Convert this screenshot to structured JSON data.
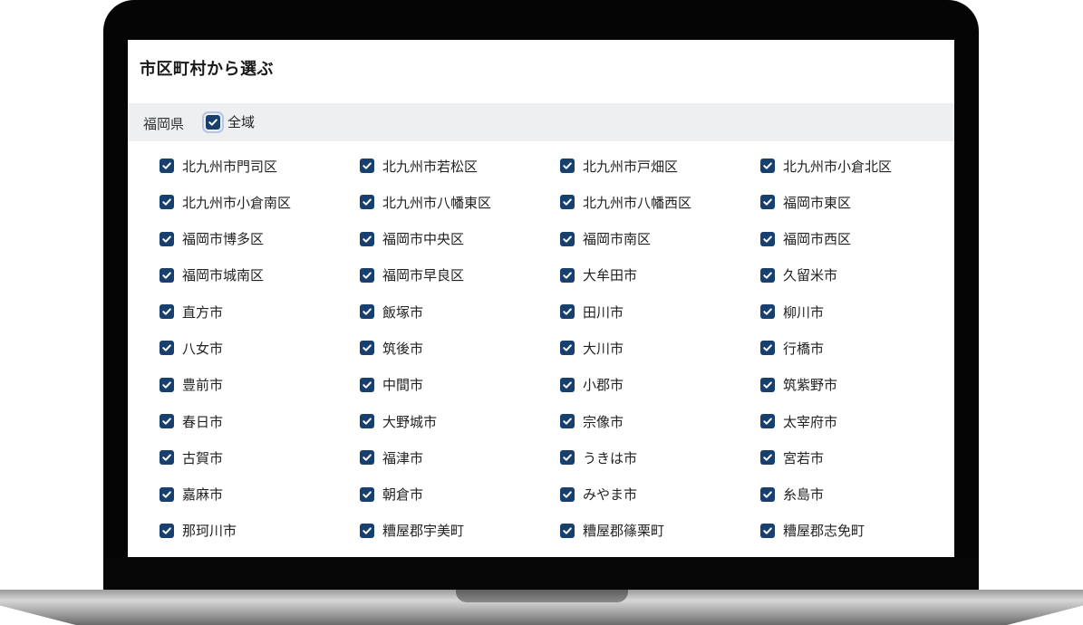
{
  "panel": {
    "title": "市区町村から選ぶ"
  },
  "prefecture": {
    "name": "福岡県",
    "all_label": "全域",
    "all_checked": true
  },
  "cities": [
    "北九州市門司区",
    "北九州市若松区",
    "北九州市戸畑区",
    "北九州市小倉北区",
    "北九州市小倉南区",
    "北九州市八幡東区",
    "北九州市八幡西区",
    "福岡市東区",
    "福岡市博多区",
    "福岡市中央区",
    "福岡市南区",
    "福岡市西区",
    "福岡市城南区",
    "福岡市早良区",
    "大牟田市",
    "久留米市",
    "直方市",
    "飯塚市",
    "田川市",
    "柳川市",
    "八女市",
    "筑後市",
    "大川市",
    "行橋市",
    "豊前市",
    "中間市",
    "小郡市",
    "筑紫野市",
    "春日市",
    "大野城市",
    "宗像市",
    "太宰府市",
    "古賀市",
    "福津市",
    "うきは市",
    "宮若市",
    "嘉麻市",
    "朝倉市",
    "みやま市",
    "糸島市",
    "那珂川市",
    "糟屋郡宇美町",
    "糟屋郡篠栗町",
    "糟屋郡志免町"
  ],
  "colors": {
    "checkbox": "#17406e",
    "pref_bar": "#eeeff1",
    "focus_ring": "#b9c3ea"
  },
  "icons": {
    "checkbox": "check-icon"
  }
}
